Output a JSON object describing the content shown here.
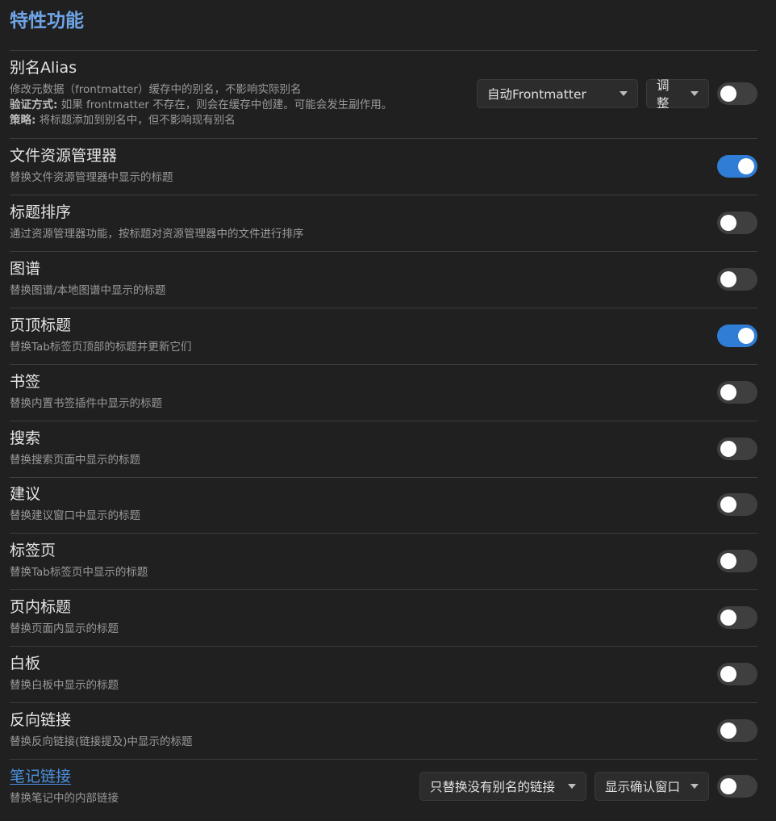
{
  "page_title": "特性功能",
  "alias": {
    "label": "别名Alias",
    "desc_line1": "修改元数据（frontmatter）缓存中的别名，不影响实际别名",
    "desc_line2_bold": "验证方式:",
    "desc_line2_rest": " 如果 frontmatter 不存在，则会在缓存中创建。可能会发生副作用。",
    "desc_line3_bold": "策略:",
    "desc_line3_rest": " 将标题添加到别名中，但不影响现有别名",
    "dropdown_value": "自动Frontmatter",
    "adjust_value": "调整",
    "enabled": false
  },
  "settings": [
    {
      "label": "文件资源管理器",
      "desc": "替换文件资源管理器中显示的标题",
      "enabled": true
    },
    {
      "label": "标题排序",
      "desc": "通过资源管理器功能，按标题对资源管理器中的文件进行排序",
      "enabled": false
    },
    {
      "label": "图谱",
      "desc": "替换图谱/本地图谱中显示的标题",
      "enabled": false
    },
    {
      "label": "页顶标题",
      "desc": "替换Tab标签页顶部的标题并更新它们",
      "enabled": true
    },
    {
      "label": "书签",
      "desc": "替换内置书签插件中显示的标题",
      "enabled": false
    },
    {
      "label": "搜索",
      "desc": "替换搜索页面中显示的标题",
      "enabled": false
    },
    {
      "label": "建议",
      "desc": "替换建议窗口中显示的标题",
      "enabled": false
    },
    {
      "label": "标签页",
      "desc": "替换Tab标签页中显示的标题",
      "enabled": false
    },
    {
      "label": "页内标题",
      "desc": "替换页面内显示的标题",
      "enabled": false
    },
    {
      "label": "白板",
      "desc": "替换白板中显示的标题",
      "enabled": false
    },
    {
      "label": "反向链接",
      "desc": "替换反向链接(链接提及)中显示的标题",
      "enabled": false
    }
  ],
  "note_links": {
    "label": "笔记链接",
    "desc": "替换笔记中的内部链接",
    "dropdown1_value": "只替换没有别名的链接",
    "dropdown2_value": "显示确认窗口",
    "enabled": false
  }
}
